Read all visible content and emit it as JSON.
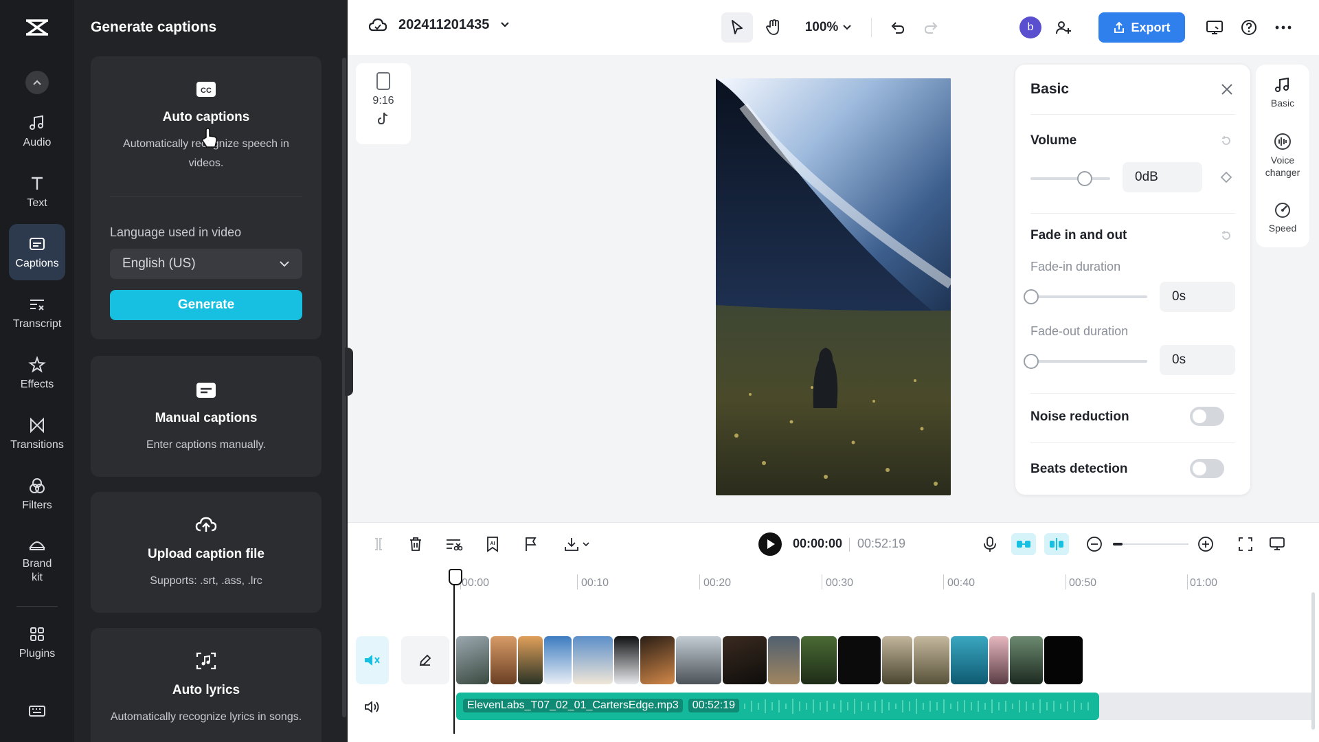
{
  "rail": {
    "items": [
      {
        "label": "Audio",
        "icon": "music-note-icon"
      },
      {
        "label": "Text",
        "icon": "text-icon"
      },
      {
        "label": "Captions",
        "icon": "captions-icon",
        "active": true
      },
      {
        "label": "Transcript",
        "icon": "transcript-icon"
      },
      {
        "label": "Effects",
        "icon": "effects-star-icon"
      },
      {
        "label": "Transitions",
        "icon": "transitions-icon"
      },
      {
        "label": "Filters",
        "icon": "filters-icon"
      },
      {
        "label": "Brand\nkit",
        "icon": "brand-kit-icon"
      },
      {
        "label": "Plugins",
        "icon": "plugins-grid-icon"
      }
    ]
  },
  "captions_panel": {
    "title": "Generate captions",
    "auto": {
      "title": "Auto captions",
      "desc": "Automatically recognize speech in videos.",
      "lang_label": "Language used in video",
      "lang_value": "English (US)",
      "generate": "Generate"
    },
    "manual": {
      "title": "Manual captions",
      "desc": "Enter captions manually."
    },
    "upload": {
      "title": "Upload caption file",
      "desc": "Supports: .srt, .ass, .lrc"
    },
    "lyrics": {
      "title": "Auto lyrics",
      "desc": "Automatically recognize lyrics in songs."
    }
  },
  "topbar": {
    "project_name": "202411201435",
    "zoom": "100%",
    "avatar_letter": "b",
    "export": "Export"
  },
  "canvas": {
    "ratio": "9:16"
  },
  "basic_panel": {
    "title": "Basic",
    "volume_label": "Volume",
    "volume_value": "0dB",
    "volume_level": 0.68,
    "fade_label": "Fade in and out",
    "fade_in_label": "Fade-in duration",
    "fade_in_value": "0s",
    "fade_out_label": "Fade-out duration",
    "fade_out_value": "0s",
    "noise_label": "Noise reduction",
    "beats_label": "Beats detection"
  },
  "side_tabs": [
    {
      "label": "Basic",
      "icon": "music-note-icon"
    },
    {
      "label": "Voice\nchanger",
      "icon": "voice-changer-icon"
    },
    {
      "label": "Speed",
      "icon": "speed-icon"
    }
  ],
  "timeline": {
    "current_time": "00:00:00",
    "total_time": "00:52:19",
    "ruler": [
      "00:00",
      "00:10",
      "00:20",
      "00:30",
      "00:40",
      "00:50",
      "01:00"
    ],
    "audio_name": "ElevenLabs_T07_02_01_CartersEdge.mp3",
    "audio_duration": "00:52:19"
  },
  "colors": {
    "accent": "#17c0e0",
    "export": "#2f80ed",
    "audio_track": "#14b89b"
  }
}
